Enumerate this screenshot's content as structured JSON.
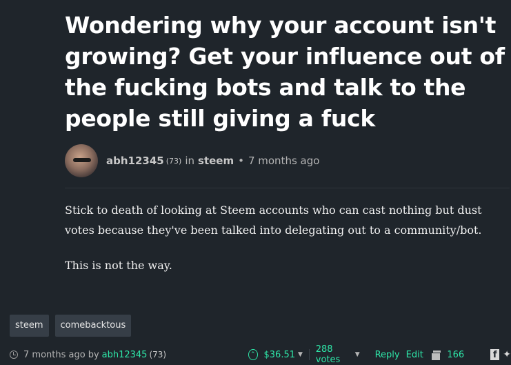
{
  "post": {
    "title": "Wondering why your account isn't growing? Get your influence out of the fucking bots and talk to the people still giving a fuck",
    "author": "abh12345",
    "reputation": "(73)",
    "in_label": "in",
    "community": "steem",
    "bullet": "•",
    "time_ago": "7 months ago",
    "body": [
      "Stick to death of looking at Steem accounts who can cast nothing but dust votes because they've been talked into delegating out to a community/bot.",
      "This is not the way."
    ]
  },
  "tags": [
    "steem",
    "comebacktous"
  ],
  "footer": {
    "time_ago": "7 months ago",
    "by_label": "by",
    "author": "abh12345",
    "reputation": "(73)",
    "payout": "$36.51",
    "votes": "288 votes",
    "reply_label": "Reply",
    "edit_label": "Edit",
    "comments_count": "166"
  },
  "icons": {
    "clock": "clock-icon",
    "upvote": "upvote-chevron-icon",
    "comments": "comments-icon",
    "facebook": "facebook-icon",
    "twitter": "twitter-icon"
  },
  "colors": {
    "background": "#1f252b",
    "accent": "#2ee6a8",
    "tag_bg": "#363e47"
  }
}
